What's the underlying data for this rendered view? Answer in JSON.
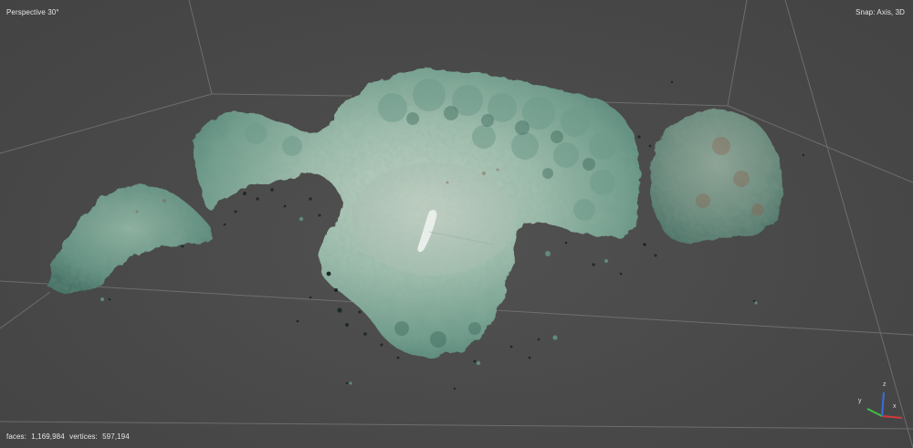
{
  "viewport": {
    "view_mode": "Perspective 30°",
    "snap_mode": "Snap: Axis, 3D",
    "stats": {
      "faces_label": "faces:",
      "faces_value": "1,169,984",
      "vertices_label": "vertices:",
      "vertices_value": "597,194"
    }
  },
  "gizmo": {
    "x_label": "x",
    "y_label": "y",
    "z_label": "z",
    "x_color": "#d23b3b",
    "y_color": "#3fbf4a",
    "z_color": "#3a6ee0"
  },
  "colors": {
    "background": "#4a4a4a",
    "grid_line": "#7a7a7a",
    "mesh_base": "#7aa898",
    "mesh_highlight": "#b9cfc0",
    "mesh_shadow": "#3f6e60",
    "debris": "#1d2a26"
  },
  "icons": {
    "mesh": "photogrammetry-mesh-icon",
    "gizmo": "axis-gizmo-icon"
  }
}
